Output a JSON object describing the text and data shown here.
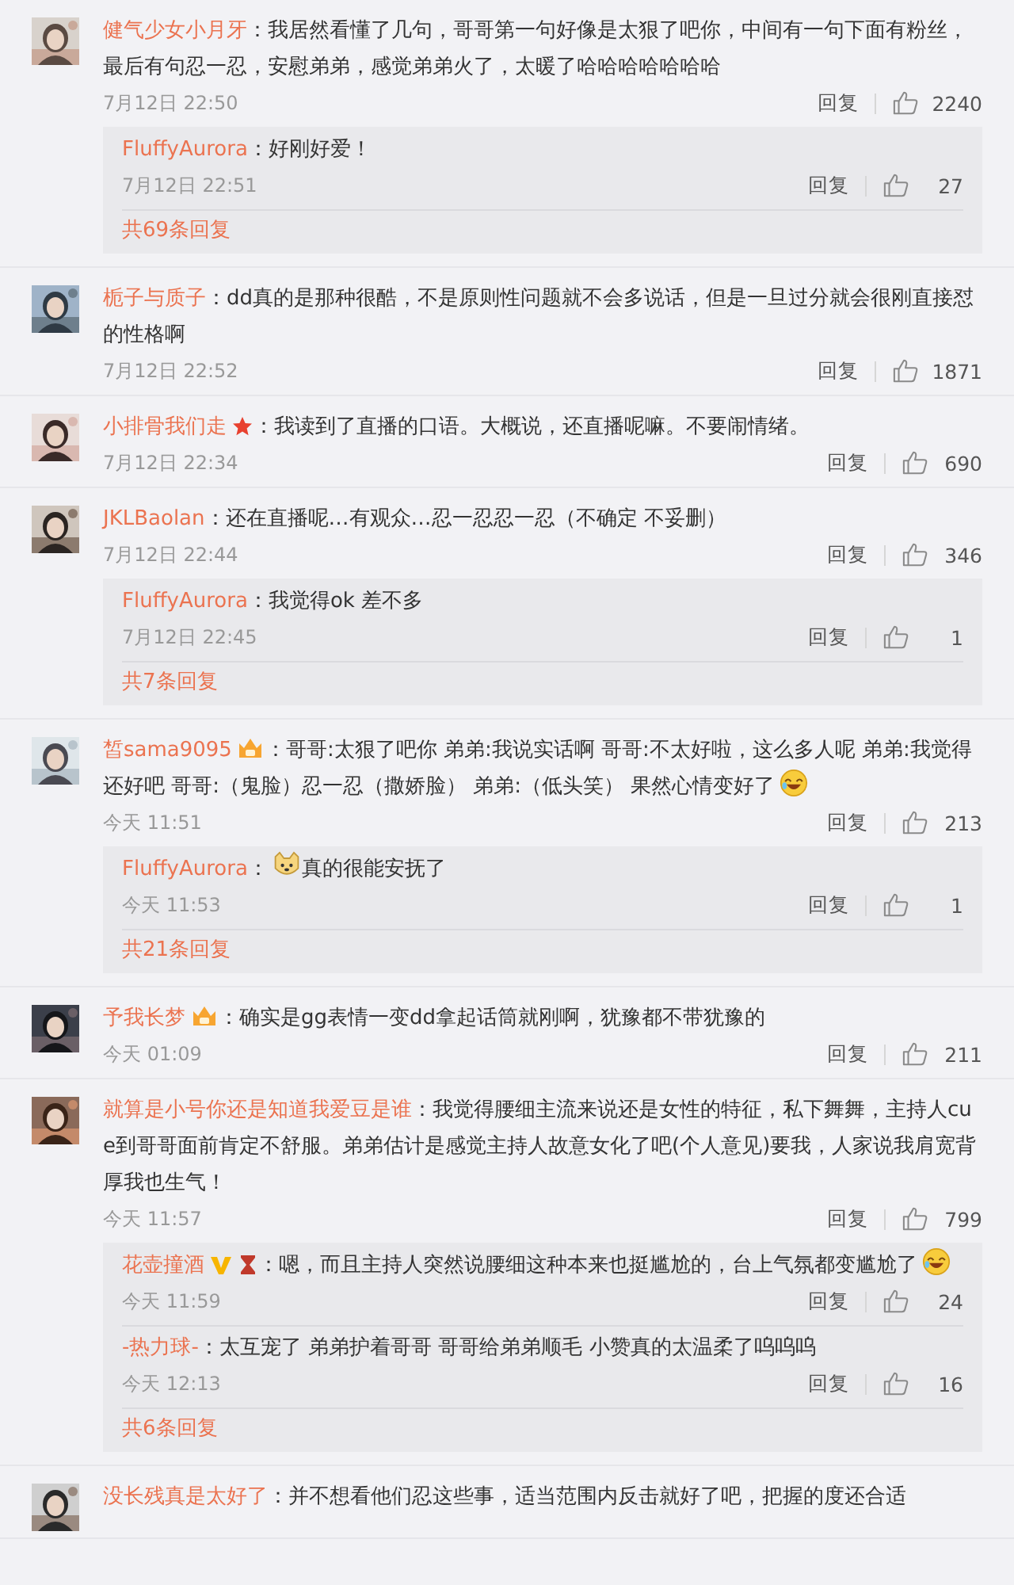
{
  "comments": [
    {
      "user": "健气少女小月牙",
      "text": "：我居然看懂了几句，哥哥第一句好像是太狠了吧你，中间有一句下面有粉丝，最后有句忍一忍，安慰弟弟，感觉弟弟火了，太暖了哈哈哈哈哈哈哈",
      "time": "7月12日 22:50",
      "reply_label": "回复",
      "likes": "2240",
      "replies": [
        {
          "user": "FluffyAurora",
          "text": "：好刚好爱！",
          "time": "7月12日 22:51",
          "reply_label": "回复",
          "likes": "27"
        }
      ],
      "more": "共69条回复"
    },
    {
      "user": "栀子与质子",
      "text": "：dd真的是那种很酷，不是原则性问题就不会多说话，但是一旦过分就会很刚直接怼的性格啊",
      "time": "7月12日 22:52",
      "reply_label": "回复",
      "likes": "1871"
    },
    {
      "user": "小排骨我们走",
      "badges": [
        {
          "kind": "star"
        }
      ],
      "text": "：我读到了直播的口语。大概说，还直播呢嘛。不要闹情绪。",
      "time": "7月12日 22:34",
      "reply_label": "回复",
      "likes": "690"
    },
    {
      "user": "JKLBaolan",
      "text": "：还在直播呢…有观众…忍一忍忍一忍（不确定 不妥删）",
      "time": "7月12日 22:44",
      "reply_label": "回复",
      "likes": "346",
      "replies": [
        {
          "user": "FluffyAurora",
          "text": "：我觉得ok 差不多",
          "time": "7月12日 22:45",
          "reply_label": "回复",
          "likes": "1"
        }
      ],
      "more": "共7条回复"
    },
    {
      "user": "皙sama9095",
      "badges": [
        {
          "kind": "fan"
        }
      ],
      "text": "：哥哥:太狠了吧你 弟弟:我说实话啊 哥哥:不太好啦，这么多人呢 弟弟:我觉得还好吧 哥哥:（鬼脸）忍一忍（撒娇脸） 弟弟:（低头笑） 果然心情变好了",
      "emoji_end": {
        "kind": "laugh"
      },
      "time": "今天 11:51",
      "reply_label": "回复",
      "likes": "213",
      "replies": [
        {
          "user": "FluffyAurora",
          "text_before": "：",
          "emoji_start": {
            "kind": "dog"
          },
          "text": "真的很能安抚了",
          "time": "今天 11:53",
          "reply_label": "回复",
          "likes": "1"
        }
      ],
      "more": "共21条回复"
    },
    {
      "user": "予我长梦",
      "badges": [
        {
          "kind": "fan"
        }
      ],
      "text": "：确实是gg表情一变dd拿起话筒就刚啊，犹豫都不带犹豫的",
      "time": "今天 01:09",
      "reply_label": "回复",
      "likes": "211"
    },
    {
      "user": "就算是小号你还是知道我爱豆是谁",
      "text": "：我觉得腰细主流来说还是女性的特征，私下舞舞，主持人cue到哥哥面前肯定不舒服。弟弟估计是感觉主持人故意女化了吧(个人意见)要我，人家说我肩宽背厚我也生气！",
      "time": "今天 11:57",
      "reply_label": "回复",
      "likes": "799",
      "replies": [
        {
          "user": "花壶撞酒",
          "badges": [
            {
              "kind": "verified"
            },
            {
              "kind": "hourglass"
            }
          ],
          "text": "：嗯，而且主持人突然说腰细这种本来也挺尴尬的，台上气氛都变尴尬了",
          "emoji_end": {
            "kind": "laugh"
          },
          "time": "今天 11:59",
          "reply_label": "回复",
          "likes": "24"
        },
        {
          "user": "-热力球-",
          "text": "：太互宠了 弟弟护着哥哥 哥哥给弟弟顺毛 小赞真的太温柔了呜呜呜",
          "time": "今天 12:13",
          "reply_label": "回复",
          "likes": "16"
        }
      ],
      "more": "共6条回复"
    },
    {
      "user": "没长残真是太好了",
      "text": "：并不想看他们忍这些事，适当范围内反击就好了吧，把握的度还合适"
    }
  ]
}
